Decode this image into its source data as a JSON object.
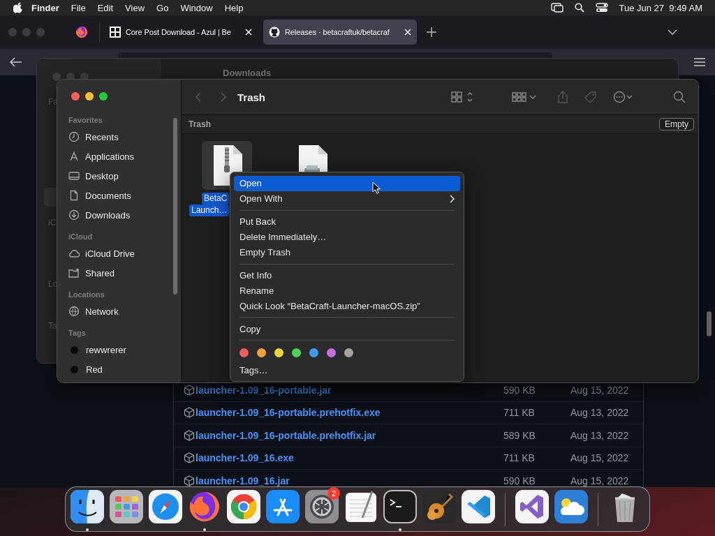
{
  "menu_bar": {
    "app_name": "Finder",
    "menus": [
      "File",
      "Edit",
      "View",
      "Go",
      "Window",
      "Help"
    ],
    "clock": "Tue Jun 27  9:49 AM"
  },
  "browser": {
    "tabs": [
      {
        "title": "Core Post Download - Azul | Be",
        "selected": false
      },
      {
        "title": "Releases · betacraftuk/betacraf",
        "selected": true
      }
    ],
    "assets": [
      {
        "name": "launcher-1.09_16-portable.jar",
        "size": "590 KB",
        "date": "Aug 15, 2022"
      },
      {
        "name": "launcher-1.09_16-portable.prehotfix.exe",
        "size": "711 KB",
        "date": "Aug 13, 2022"
      },
      {
        "name": "launcher-1.09_16-portable.prehotfix.jar",
        "size": "589 KB",
        "date": "Aug 13, 2022"
      },
      {
        "name": "launcher-1.09_16.exe",
        "size": "711 KB",
        "date": "Aug 15, 2022"
      },
      {
        "name": "launcher-1.09_16.jar",
        "size": "590 KB",
        "date": "Aug 15, 2022"
      }
    ]
  },
  "background_finder": {
    "title": "Downloads",
    "sidebar_fragments": [
      "Fa",
      "iC",
      "Lo",
      "Ta"
    ]
  },
  "finder": {
    "title": "Trash",
    "path": "Trash",
    "empty_button": "Empty",
    "sidebar": [
      {
        "heading": "Favorites",
        "kind": "places",
        "items": [
          {
            "label": "Recents"
          },
          {
            "label": "Applications"
          },
          {
            "label": "Desktop"
          },
          {
            "label": "Documents"
          },
          {
            "label": "Downloads"
          }
        ]
      },
      {
        "heading": "iCloud",
        "kind": "places",
        "items": [
          {
            "label": "iCloud Drive"
          },
          {
            "label": "Shared"
          }
        ]
      },
      {
        "heading": "Locations",
        "kind": "places",
        "items": [
          {
            "label": "Network"
          }
        ]
      },
      {
        "heading": "Tags",
        "kind": "tags",
        "items": [
          {
            "label": "rewwrerer"
          },
          {
            "label": "Red"
          }
        ]
      }
    ],
    "files": [
      {
        "kind": "zip",
        "selected": true,
        "name_lines": [
          "BetaC",
          "Launch…"
        ]
      },
      {
        "kind": "installer",
        "selected": false
      }
    ]
  },
  "context_menu": {
    "groups": [
      [
        {
          "label": "Open",
          "selected": true,
          "submenu": false
        },
        {
          "label": "Open With",
          "selected": false,
          "submenu": true
        }
      ],
      [
        {
          "label": "Put Back",
          "selected": false,
          "submenu": false
        },
        {
          "label": "Delete Immediately…",
          "selected": false,
          "submenu": false
        },
        {
          "label": "Empty Trash",
          "selected": false,
          "submenu": false
        }
      ],
      [
        {
          "label": "Get Info",
          "selected": false,
          "submenu": false
        },
        {
          "label": "Rename",
          "selected": false,
          "submenu": false
        },
        {
          "label": "Quick Look “BetaCraft-Launcher-macOS.zip”",
          "selected": false,
          "submenu": false
        }
      ],
      [
        {
          "label": "Copy",
          "selected": false,
          "submenu": false
        }
      ]
    ],
    "tag_colors": [
      {
        "color": "#ec5f5d"
      },
      {
        "color": "#f5a03a"
      },
      {
        "color": "#f5d33a"
      },
      {
        "color": "#4fd25e"
      },
      {
        "color": "#3a9bf5"
      },
      {
        "color": "#c66ee6"
      },
      {
        "color": "#a4a4a4"
      }
    ],
    "tags_item": "Tags…"
  },
  "dock": {
    "groups": [
      [
        {
          "running": true
        },
        {
          "running": false
        },
        {
          "running": false
        },
        {
          "running": true
        },
        {
          "running": false
        },
        {
          "running": false
        },
        {
          "running": false,
          "badge": "2"
        },
        {
          "running": false
        },
        {
          "running": true
        },
        {
          "running": false
        },
        {
          "running": false
        }
      ],
      [
        {
          "running": false
        },
        {
          "running": false
        }
      ],
      [
        {
          "running": false
        }
      ]
    ]
  }
}
